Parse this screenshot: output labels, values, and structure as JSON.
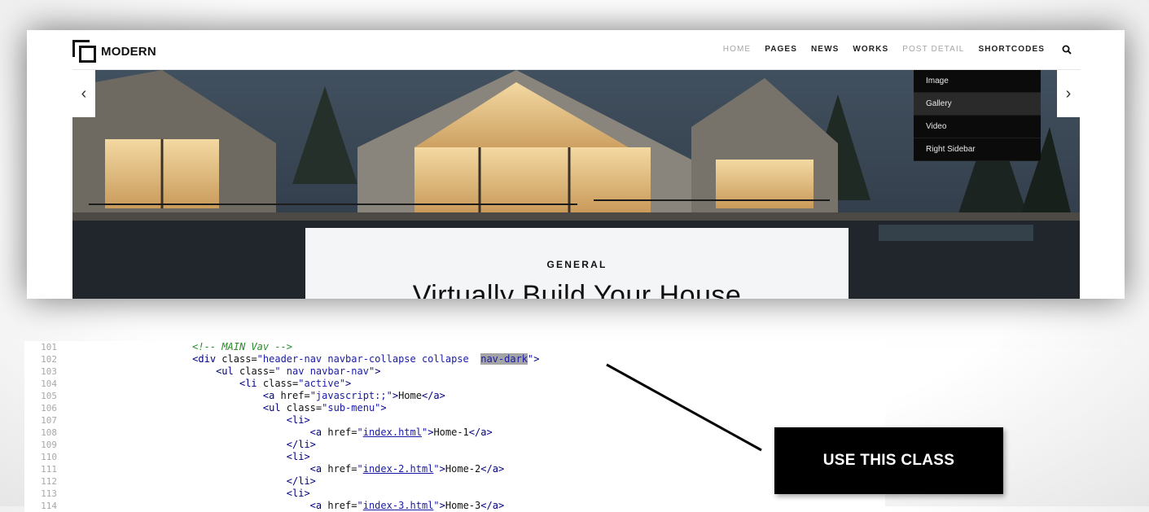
{
  "site": {
    "logo_text": "MODERN",
    "nav": [
      {
        "label": "HOME",
        "muted": true
      },
      {
        "label": "PAGES",
        "muted": false
      },
      {
        "label": "NEWS",
        "muted": false
      },
      {
        "label": "WORKS",
        "muted": false
      },
      {
        "label": "POST DETAIL",
        "muted": true
      },
      {
        "label": "SHORTCODES",
        "muted": false
      }
    ],
    "search_icon": "search-icon",
    "dropdown": [
      "Image",
      "Gallery",
      "Video",
      "Right Sidebar"
    ],
    "dropdown_highlight": "Gallery",
    "hero": {
      "prev_arrow": "‹",
      "next_arrow": "›",
      "eyebrow": "GENERAL",
      "title": "Virtually Build Your House"
    }
  },
  "code": {
    "lines": [
      {
        "n": "101",
        "indent": 16,
        "text": "<!-- MAIN Vav -->"
      },
      {
        "n": "102",
        "indent": 16,
        "text": "<div class=\"header-nav navbar-collapse collapse  nav-dark\">"
      },
      {
        "n": "103",
        "indent": 20,
        "text": "<ul class=\" nav navbar-nav\">"
      },
      {
        "n": "104",
        "indent": 24,
        "text": "<li class=\"active\">"
      },
      {
        "n": "105",
        "indent": 28,
        "text": "<a href=\"javascript:;\">Home</a>"
      },
      {
        "n": "106",
        "indent": 28,
        "text": "<ul class=\"sub-menu\">"
      },
      {
        "n": "107",
        "indent": 32,
        "text": "<li>"
      },
      {
        "n": "108",
        "indent": 36,
        "text": "<a href=\"index.html\">Home-1</a>"
      },
      {
        "n": "109",
        "indent": 32,
        "text": "</li>"
      },
      {
        "n": "110",
        "indent": 32,
        "text": "<li>"
      },
      {
        "n": "111",
        "indent": 36,
        "text": "<a href=\"index-2.html\">Home-2</a>"
      },
      {
        "n": "112",
        "indent": 32,
        "text": "</li>"
      },
      {
        "n": "113",
        "indent": 32,
        "text": "<li>"
      },
      {
        "n": "114",
        "indent": 36,
        "text": "<a href=\"index-3.html\">Home-3</a>"
      }
    ],
    "highlighted_class": "nav-dark"
  },
  "callout": {
    "label": "USE THIS CLASS"
  },
  "colors": {
    "highlight": "#a4a4a4",
    "comment": "#2a8a2a",
    "value": "#1a1aa6"
  }
}
